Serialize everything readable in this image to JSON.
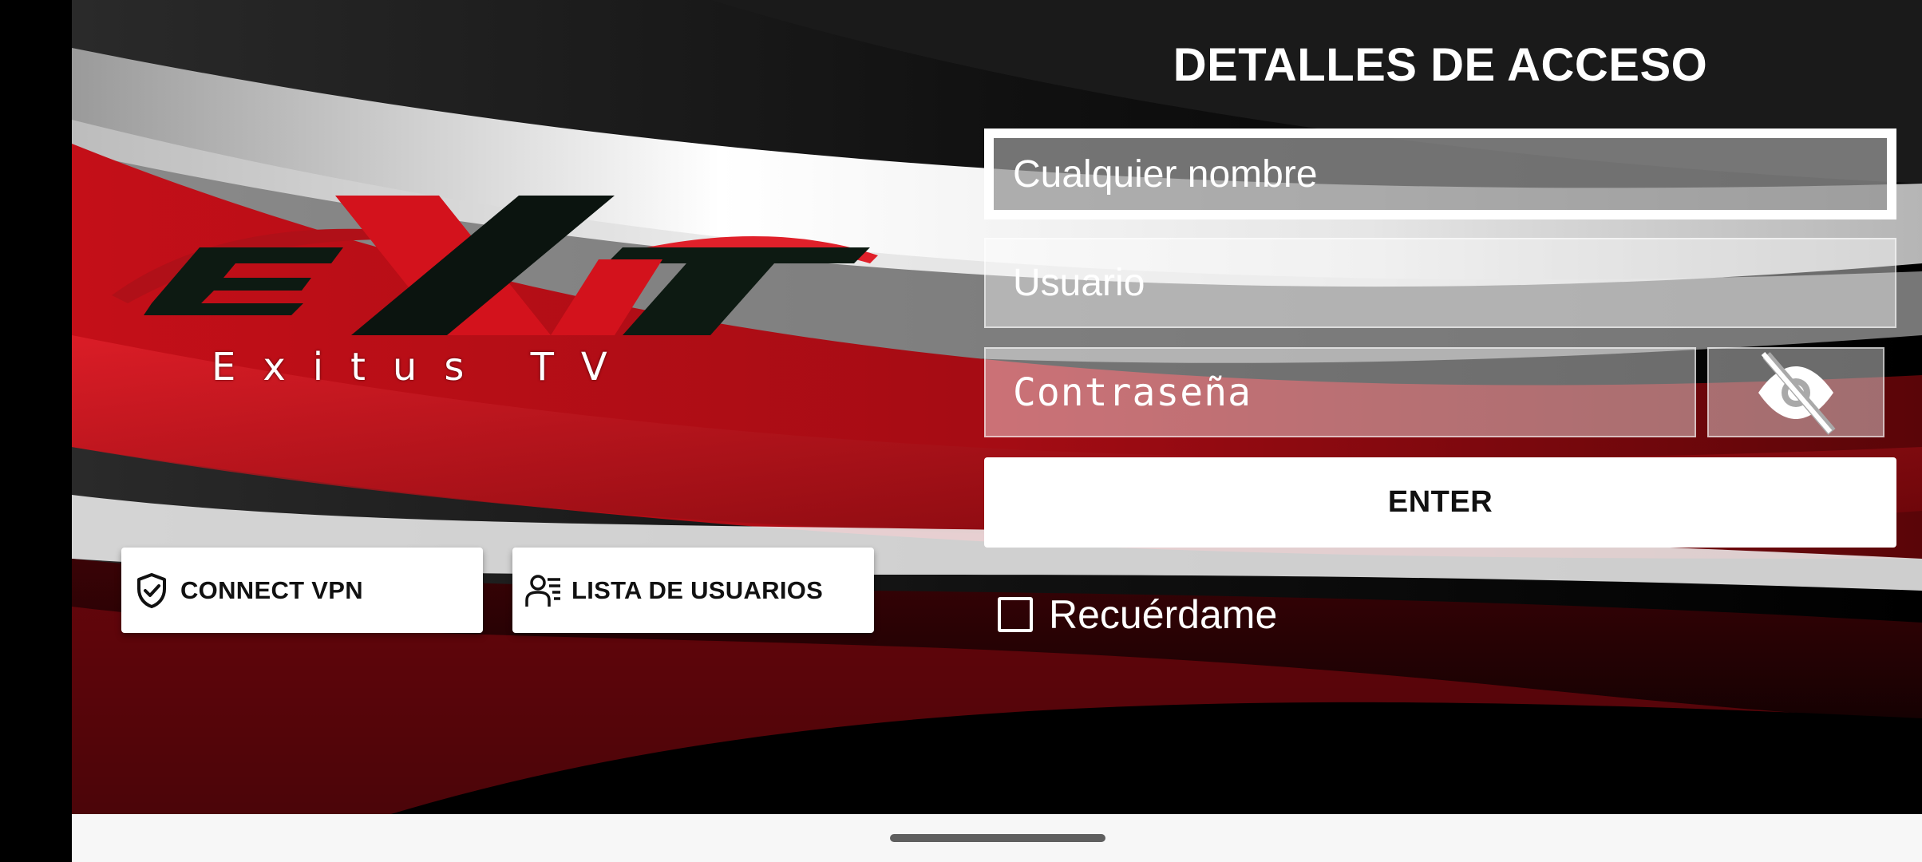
{
  "app": {
    "logo_text": "EXT",
    "logo_tagline": "Exitus TV",
    "logo_icon": "ext-logo"
  },
  "left_buttons": {
    "vpn": {
      "label": "CONNECT VPN",
      "icon": "shield-check-icon"
    },
    "users": {
      "label": "LISTA DE USUARIOS",
      "icon": "user-list-icon"
    }
  },
  "login": {
    "title": "DETALLES DE ACCESO",
    "name_placeholder": "Cualquier nombre",
    "user_placeholder": "Usuario",
    "password_placeholder": "Contraseña",
    "toggle_icon": "eye-off-icon",
    "enter_label": "ENTER",
    "remember_label": "Recuérdame",
    "remember_checked": false
  },
  "colors": {
    "accent_red": "#d3121c",
    "dark": "#0a0a0a",
    "white": "#ffffff"
  }
}
